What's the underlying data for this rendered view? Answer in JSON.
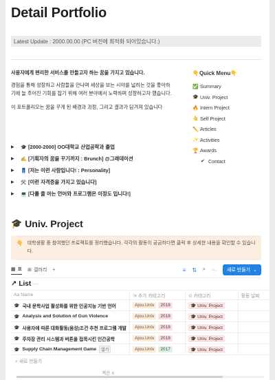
{
  "page": {
    "title": "Detail Portfolio",
    "update": "Latest Update : 2000.00.00 (PC 버전에 최적화 되어있습니다.)"
  },
  "intro": {
    "line1": "사용자에게 편리한 서비스를 만들고자 하는 꿈을 가지고 있습니다.",
    "line2": "경험을 통해 성장하고 사람들을 만나며 세상을 보는 시야를 넓히는 것을 좋아하기에 늘 주어진 기회를 잡기 위해 여러 분야에서 노력하며 성장하고자 했습니다.",
    "line3": "이 포트폴리오는 꿈을 꾸게 된 배경과 과정, 그리고 결과가 담겨져 있습니다"
  },
  "toggles": [
    {
      "icon": "🎓",
      "label": "[2000-2000] OO대학교 산업공학과 졸업"
    },
    {
      "icon": "✍️",
      "label": "[기획자의 꿈을 꾸기까지 : Brunch] @그래데이션"
    },
    {
      "icon": "👖",
      "label": "[저는 이런 사람입니다! : Personality]"
    },
    {
      "icon": "⚒️",
      "label": "[이런 자격증을 가지고 있습니다]"
    },
    {
      "icon": "💻",
      "label": "[다룰 줄 아는 언어와 프로그램은 이정도 입니다!]"
    }
  ],
  "menu": {
    "title": "👇Quick Menu👇",
    "items": [
      {
        "icon": "✅",
        "label": "Summary",
        "indent": false
      },
      {
        "icon": "🎓",
        "label": "Univ. Project",
        "indent": false
      },
      {
        "icon": "🔥",
        "label": "Intern Project",
        "indent": false
      },
      {
        "icon": "👆",
        "label": "Self Project",
        "indent": false
      },
      {
        "icon": "✏️",
        "label": "Articles",
        "indent": false
      },
      {
        "icon": "✨",
        "label": "Activities",
        "indent": false
      },
      {
        "icon": "🏆",
        "label": "Awards",
        "indent": false
      },
      {
        "icon": "✔",
        "label": "Contact",
        "indent": true
      }
    ]
  },
  "section": {
    "icon": "🎓",
    "title": "Univ. Project"
  },
  "callout": {
    "icon": "👇",
    "text": "대학생활 중 참여했던 프로젝트를 정리했습니다. 각각의 활동이 궁금하다면 클릭 후 상세한 내용을 확인할 수 있습니다."
  },
  "db": {
    "tabs": [
      "표",
      "갤러리"
    ],
    "add": "+",
    "new_button": "새로 만들기",
    "list_title": "List",
    "list_more": "···",
    "columns": [
      "Aa Name",
      "⁝≡ 추가 카테고리",
      "⊙ 카테고리",
      "활동 날짜"
    ],
    "rows": [
      {
        "name": "국내 문학사업 활성화를 위한 인공지능 기반 언어",
        "tags": [
          "Ajou.Univ",
          "2018"
        ],
        "category": "Univ. Project",
        "open": false,
        "year_class": "y2018"
      },
      {
        "name": "Analysis and Solution of Gun Violence",
        "tags": [
          "Ajou.Univ",
          "2018"
        ],
        "category": "Univ. Project",
        "open": false,
        "year_class": "y2018"
      },
      {
        "name": "사용자에 따른 대화활동(음성)조건 추천 프로그램 개발",
        "tags": [
          "Ajou.Univ",
          "2018"
        ],
        "category": "Univ. Project",
        "open": false,
        "year_class": "y2018"
      },
      {
        "name": "주차장 관리 시스템과 버튼을 접목시킨 인간공학",
        "tags": [
          "Ajou.Univ",
          "2018"
        ],
        "category": "Univ. Project",
        "open": false,
        "year_class": "y2018"
      },
      {
        "name": "Supply Chain Management Game",
        "tags": [
          "Ajou.Univ",
          "2017"
        ],
        "category": "Univ. Project",
        "open": true,
        "open_label": "열기",
        "year_class": "y2017"
      }
    ],
    "new_row": "+ 새로 만들기",
    "calc": "계산 ∨"
  },
  "colors": {
    "accent": "#2383e2",
    "callout_bg": "#fbeee1",
    "univ_tag": "#fbecdd",
    "year_2018": "#f6e1e7",
    "year_2017": "#e3efe6",
    "category_tag": "#fbe4e4"
  }
}
